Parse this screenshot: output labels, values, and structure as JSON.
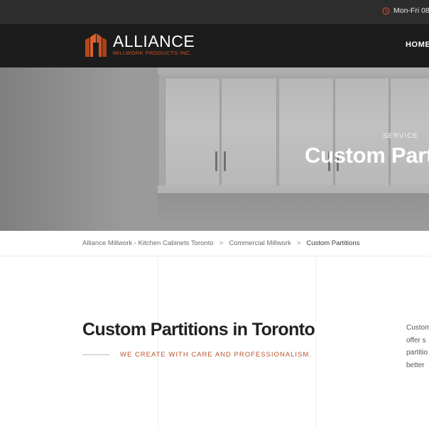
{
  "topbar": {
    "hours": "Mon-Fri 08"
  },
  "header": {
    "logo_name": "ALLIANCE",
    "logo_sub": "MILLWORK PRODUCTS INC.",
    "nav_home": "HOME"
  },
  "hero": {
    "kicker": "SERVICE",
    "title": "Custom Partitions"
  },
  "breadcrumb": {
    "items": [
      "Alliance Millwork - Kitchen Cabinets Toronto",
      "Commercial Millwork",
      "Custom Partitions"
    ],
    "separator": ">"
  },
  "content": {
    "heading": "Custom Partitions in Toronto",
    "tagline": "WE CREATE WITH CARE AND PROFESSIONALISM.",
    "intro_lines": [
      "Custom",
      "offer s",
      "partitio",
      "better"
    ]
  },
  "colors": {
    "accent": "#c6532a",
    "topbar_bg": "#2d2d2d",
    "header_bg": "#1c1c1c"
  }
}
